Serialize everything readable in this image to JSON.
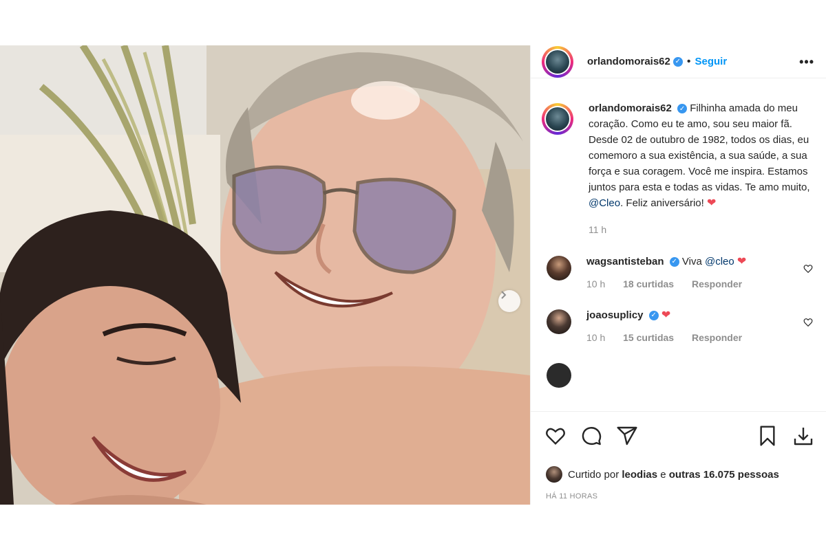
{
  "post": {
    "username": "orlandomorais62",
    "follow_label": "Seguir",
    "more_label": "•••",
    "caption": {
      "username": "orlandomorais62",
      "text_before_mention": "Filhinha amada do meu coração. Como eu te amo, sou seu maior fã. Desde 02 de outubro de 1982, todos os dias, eu comemoro a sua existência, a sua saúde, a sua força e sua coragem. Você me inspira. Estamos juntos para esta e todas as vidas. Te amo muito,",
      "mention": "@Cleo",
      "text_after_mention": ". Feliz aniversário!",
      "heart": "❤",
      "time": "11 h"
    },
    "comments": [
      {
        "username": "wagsantisteban",
        "text_before": "Viva",
        "mention": "@cleo",
        "heart": "❤",
        "time": "10 h",
        "likes": "18 curtidas",
        "reply_label": "Responder"
      },
      {
        "username": "joaosuplicy",
        "text_before": "",
        "mention": "",
        "heart": "❤",
        "time": "10 h",
        "likes": "15 curtidas",
        "reply_label": "Responder"
      }
    ],
    "liked_by": {
      "prefix": "Curtido por",
      "user": "leodias",
      "connector": "e",
      "others": "outras 16.075 pessoas"
    },
    "time_ago": "HÁ 11 HORAS",
    "icons": {
      "like": "heart-outline-icon",
      "comment": "comment-bubble-icon",
      "share": "paper-plane-icon",
      "save": "bookmark-icon",
      "download": "download-icon",
      "next": "chevron-right-icon"
    },
    "colors": {
      "link": "#00376b",
      "follow": "#0095f6",
      "verified": "#3897f0",
      "heart": "#ed4956"
    }
  }
}
